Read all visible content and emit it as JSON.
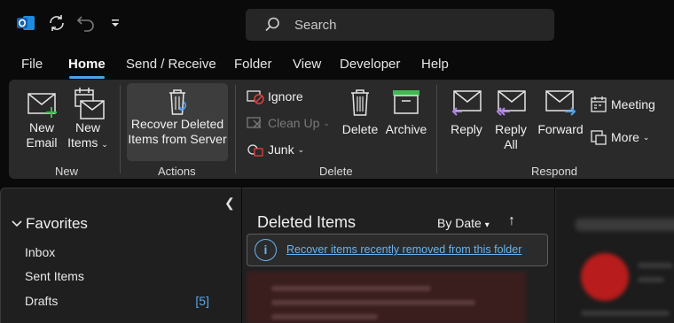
{
  "titlebar": {
    "search_placeholder": "Search"
  },
  "menu": {
    "tabs": [
      {
        "label": "File"
      },
      {
        "label": "Home"
      },
      {
        "label": "Send / Receive"
      },
      {
        "label": "Folder"
      },
      {
        "label": "View"
      },
      {
        "label": "Developer"
      },
      {
        "label": "Help"
      }
    ],
    "active": "Home"
  },
  "ribbon": {
    "groups": {
      "new": "New",
      "actions": "Actions",
      "delete": "Delete",
      "respond": "Respond"
    },
    "new_email": [
      "New",
      "Email"
    ],
    "new_items": [
      "New",
      "Items"
    ],
    "recover": [
      "Recover Deleted",
      "Items from Server"
    ],
    "ignore": "Ignore",
    "clean_up": "Clean Up",
    "junk": "Junk",
    "delete": "Delete",
    "archive": "Archive",
    "reply": "Reply",
    "reply_all": [
      "Reply",
      "All"
    ],
    "forward": "Forward",
    "meeting": "Meeting",
    "more": "More"
  },
  "folders": {
    "favorites_label": "Favorites",
    "items": [
      {
        "label": "Inbox",
        "count": ""
      },
      {
        "label": "Sent Items",
        "count": ""
      },
      {
        "label": "Drafts",
        "count": "[5]"
      }
    ]
  },
  "message_list": {
    "title": "Deleted Items",
    "sort_label": "By Date",
    "info_link": "Recover items recently removed from this folder"
  },
  "colors": {
    "accent": "#4aa3ee",
    "outlook_blue": "#1473d6",
    "archive_green": "#3fb950",
    "reply_purple": "#b084e6"
  }
}
